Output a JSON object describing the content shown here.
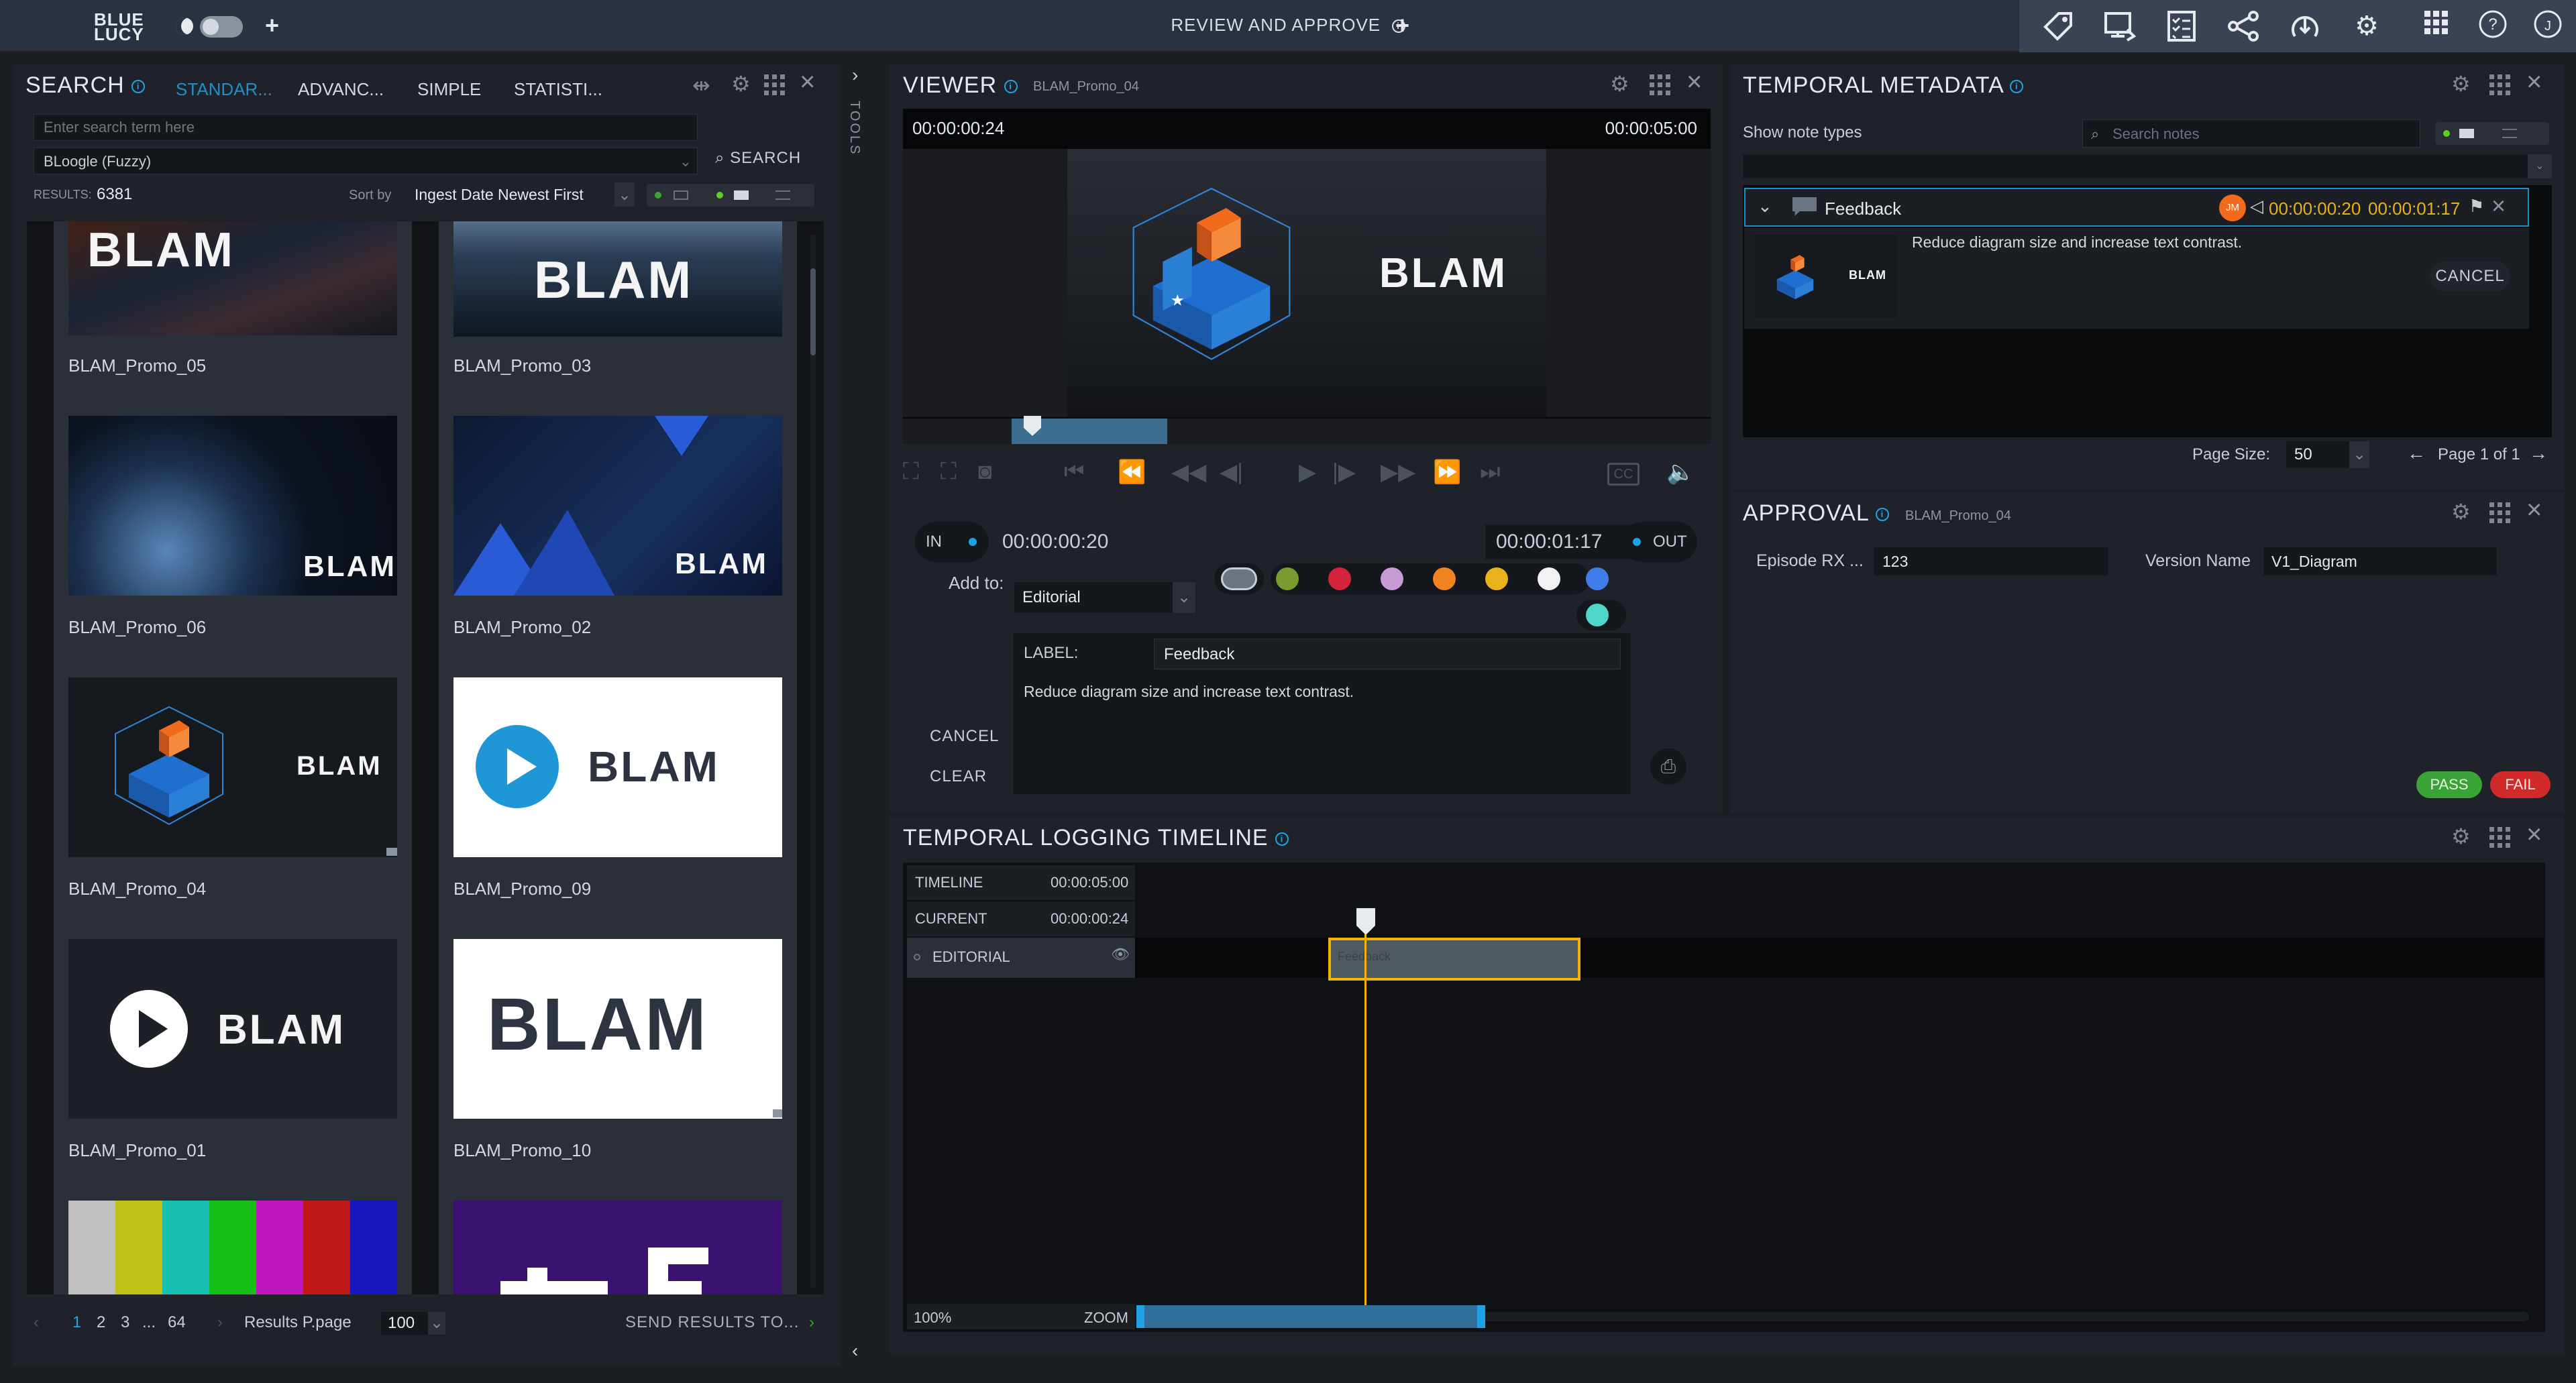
{
  "topbar": {
    "brand_line1": "BLUE",
    "brand_line2": "LUCY",
    "title": "REVIEW AND APPROVE",
    "icons": [
      "tag-icon",
      "review-monitor-icon",
      "checklist-icon",
      "workflow-icon",
      "transfer-icon",
      "gear-icon",
      "grid-icon",
      "help-icon",
      "user-icon"
    ],
    "user_initial": "J"
  },
  "search": {
    "title": "SEARCH",
    "tabs": [
      "STANDAR...",
      "ADVANC...",
      "SIMPLE",
      "STATISTI..."
    ],
    "placeholder": "Enter search term here",
    "engine": "BLoogle (Fuzzy)",
    "search_button": "SEARCH",
    "results_label": "RESULTS:",
    "results_count": "6381",
    "sort_label": "Sort by",
    "sort_value": "Ingest Date Newest First",
    "items": [
      {
        "label": "BLAM_Promo_05",
        "logo": "BLAM"
      },
      {
        "label": "BLAM_Promo_03",
        "logo": "BLAM"
      },
      {
        "label": "BLAM_Promo_06",
        "logo": "BLAM"
      },
      {
        "label": "BLAM_Promo_02",
        "logo": "BLAM"
      },
      {
        "label": "BLAM_Promo_04",
        "logo": "BLAM"
      },
      {
        "label": "BLAM_Promo_09",
        "logo": "BLAM"
      },
      {
        "label": "BLAM_Promo_01",
        "logo": "BLAM"
      },
      {
        "label": "BLAM_Promo_10",
        "logo": "BLAM"
      }
    ],
    "pages": [
      "1",
      "2",
      "3",
      "...",
      "64"
    ],
    "per_page_label": "Results P.page",
    "per_page_value": "100",
    "send_results": "SEND RESULTS TO..."
  },
  "tools_label": "TOOLS",
  "viewer": {
    "title": "VIEWER",
    "asset": "BLAM_Promo_04",
    "current_tc": "00:00:00:24",
    "duration_tc": "00:00:05:00",
    "logo": "BLAM",
    "in_label": "IN",
    "in_tc": "00:00:00:20",
    "out_tc": "00:00:01:17",
    "out_label": "OUT",
    "add_to_label": "Add to:",
    "add_to_value": "Editorial",
    "label_label": "LABEL:",
    "label_value": "Feedback",
    "note_text": "Reduce diagram size and increase text contrast.",
    "cancel": "CANCEL",
    "clear": "CLEAR",
    "swatches": [
      "#6b7480",
      "#7a9a2e",
      "#d4233a",
      "#c89bd6",
      "#f0831e",
      "#e9b21b",
      "#f2f2f2",
      "#3f7ee8",
      "#4fd6c8"
    ]
  },
  "temporal": {
    "title": "TEMPORAL METADATA",
    "show_label": "Show note types",
    "search_placeholder": "Search notes",
    "note_type": "Feedback",
    "avatar_initials": "JM",
    "note_in": "00:00:00:20",
    "note_out": "00:00:01:17",
    "note_text": "Reduce diagram size and increase text contrast.",
    "cancel": "CANCEL",
    "page_size_label": "Page Size:",
    "page_size_value": "50",
    "page_label": "Page 1 of 1",
    "thumb_logo": "BLAM"
  },
  "approval": {
    "title": "APPROVAL",
    "asset": "BLAM_Promo_04",
    "episode_label": "Episode RX ...",
    "episode_value": "123",
    "version_label": "Version Name",
    "version_value": "V1_Diagram",
    "pass": "PASS",
    "fail": "FAIL"
  },
  "timeline": {
    "title": "TEMPORAL LOGGING TIMELINE",
    "timeline_label": "TIMELINE",
    "timeline_tc": "00:00:05:00",
    "current_label": "CURRENT",
    "current_tc": "00:00:00:24",
    "track_label": "EDITORIAL",
    "clip_label": "Feedback",
    "zoom_pct": "100%",
    "zoom_label": "ZOOM"
  },
  "colors": {
    "accent": "#1fa3e6",
    "marker": "#f5b301",
    "pass": "#3aa335",
    "fail": "#d22a2a",
    "blam_orange": "#f26a1b"
  }
}
